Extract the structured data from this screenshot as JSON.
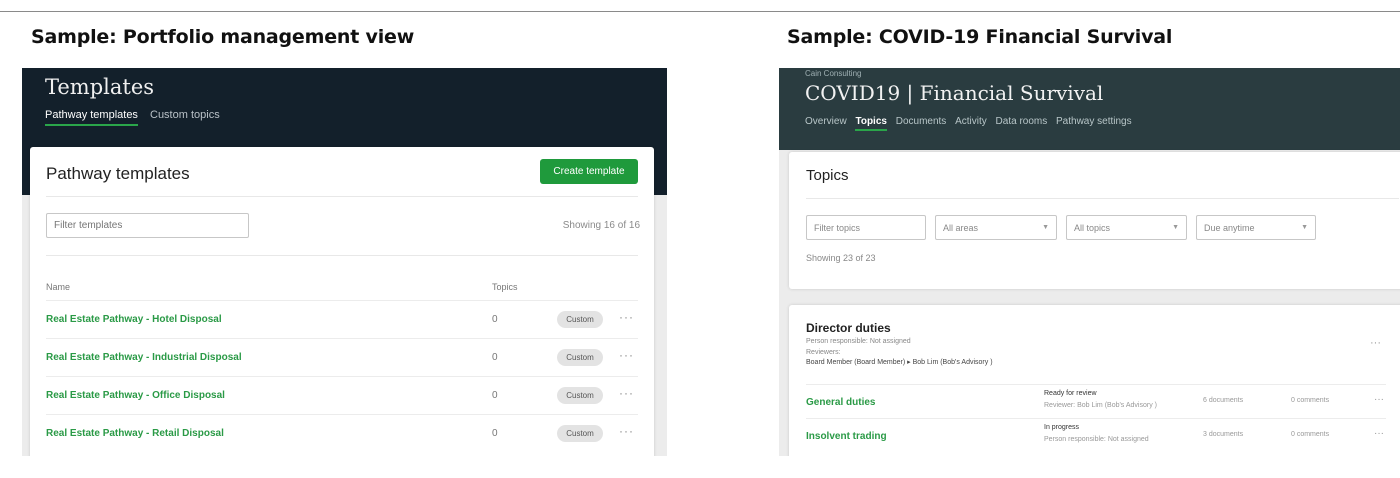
{
  "headings": {
    "left": "Sample: Portfolio management view",
    "right": "Sample: COVID-19 Financial Survival"
  },
  "portfolio": {
    "title": "Templates",
    "nav": [
      "Pathway templates",
      "Custom topics"
    ],
    "active_nav_index": 0,
    "card_title": "Pathway templates",
    "create_button": "Create template",
    "filter_placeholder": "Filter templates",
    "showing": "Showing 16 of 16",
    "columns": {
      "name": "Name",
      "topics": "Topics"
    },
    "rows": [
      {
        "name": "Real Estate Pathway - Hotel Disposal",
        "topics": "0",
        "badge": "Custom"
      },
      {
        "name": "Real Estate Pathway - Industrial Disposal",
        "topics": "0",
        "badge": "Custom"
      },
      {
        "name": "Real Estate Pathway - Office Disposal",
        "topics": "0",
        "badge": "Custom"
      },
      {
        "name": "Real Estate Pathway - Retail Disposal",
        "topics": "0",
        "badge": "Custom"
      }
    ],
    "row_menu": "···"
  },
  "covid": {
    "org": "Cain Consulting",
    "title": "COVID19 | Financial Survival",
    "nav": [
      "Overview",
      "Topics",
      "Documents",
      "Activity",
      "Data rooms",
      "Pathway settings"
    ],
    "active_nav_index": 1,
    "topics_title": "Topics",
    "filters": {
      "search_placeholder": "Filter topics",
      "areas": "All areas",
      "topics": "All topics",
      "due": "Due anytime"
    },
    "showing": "Showing 23 of 23",
    "section": {
      "title": "Director duties",
      "person": "Person responsible: Not assigned",
      "reviewers_label": "Reviewers:",
      "reviewers": "Board Member (Board Member) ▸ Bob Lim (Bob's Advisory )"
    },
    "topics": [
      {
        "name": "General duties",
        "status": "Ready for review",
        "sub": "Reviewer: Bob Lim (Bob's Advisory )",
        "docs": "6 documents",
        "comments": "0 comments"
      },
      {
        "name": "Insolvent trading",
        "status": "In progress",
        "sub": "Person responsible: Not assigned",
        "docs": "3 documents",
        "comments": "0 comments"
      }
    ],
    "row_menu": "···"
  },
  "colors": {
    "left_header_bg": "#13202b",
    "right_header_bg": "#2a3c40",
    "accent_green": "#2a9a46",
    "button_green": "#1f9a3c"
  }
}
